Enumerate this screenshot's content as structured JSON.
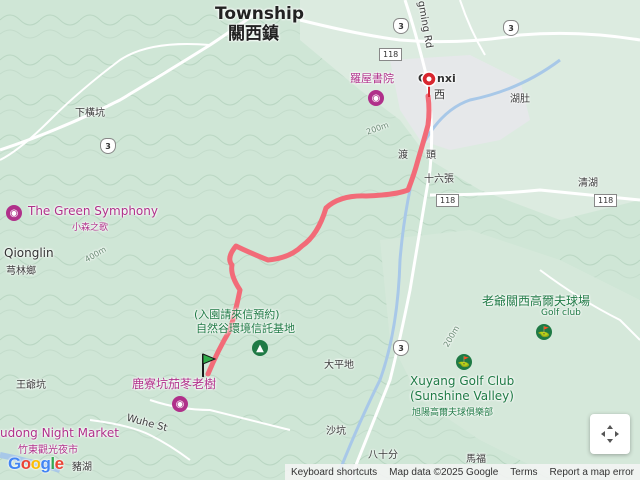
{
  "map": {
    "colors": {
      "terrain": "#cfe6d6",
      "urban": "#e6e8ea",
      "road_major": "#ffffff",
      "water": "#a8c8e8",
      "route": "#f26b78",
      "marker": "#d8262f",
      "poi_green": "#1f7a45",
      "poi_pink": "#b0308a"
    },
    "labels": {
      "township_en": "Township",
      "township_partial": "Guanxi",
      "township_zh": "關西鎮",
      "guanxi_prefix": "G",
      "guanxi_suffix": "nxi",
      "guanxi_zh_suffix": "西",
      "xiaheng_keng": "下橫坑",
      "hushi": "湖肚",
      "dujiaotou_1": "渡",
      "dujiaotou_2": "頭",
      "shiliu_zhang": "十六張",
      "qinghu": "清湖",
      "green_symphony": "The Green Symphony",
      "green_symphony_zh": "小森之歌",
      "qionglin": "Qionglin",
      "qionglin_zh": "芎林鄉",
      "reserve_line1": "(入園請來信預約)",
      "reserve_line2": "自然谷環境信託基地",
      "lujiaokeng": "鹿寮坑茄苳老樹",
      "taipingdi": "大平地",
      "wangchuankeng": "王爺坑",
      "night_market": "udong Night Market",
      "night_market_zh": "竹東觀光夜市",
      "wuhe_st": "Wuhe St",
      "zhuhu": "豬湖",
      "shakeng": "沙坑",
      "bashifen": "八十分",
      "mafu": "馬福",
      "golf_zh": "老爺關西高爾夫球場",
      "golf_en": "Golf club",
      "xuyang_golf": "Xuyang Golf Club",
      "sunshine_valley": "(Sunshine Valley)",
      "xuyang_golf_zh": "旭陽高爾夫球俱樂部",
      "luowu": "羅屋書院",
      "yangming_rd": "gming Rd",
      "elev_200": "200m",
      "elev_400": "400m"
    },
    "roads": {
      "r3": "3",
      "r118": "118"
    },
    "icons": {
      "start_marker": "green-flag-icon",
      "end_marker": "red-pin-icon",
      "park": "tree-icon",
      "attraction": "camera-icon",
      "golf": "golf-icon",
      "recenter": "recenter-icon"
    }
  },
  "footer": {
    "google_logo": "Google",
    "keyboard": "Keyboard shortcuts",
    "map_data": "Map data ©2025 Google",
    "terms": "Terms",
    "report": "Report a map error"
  }
}
